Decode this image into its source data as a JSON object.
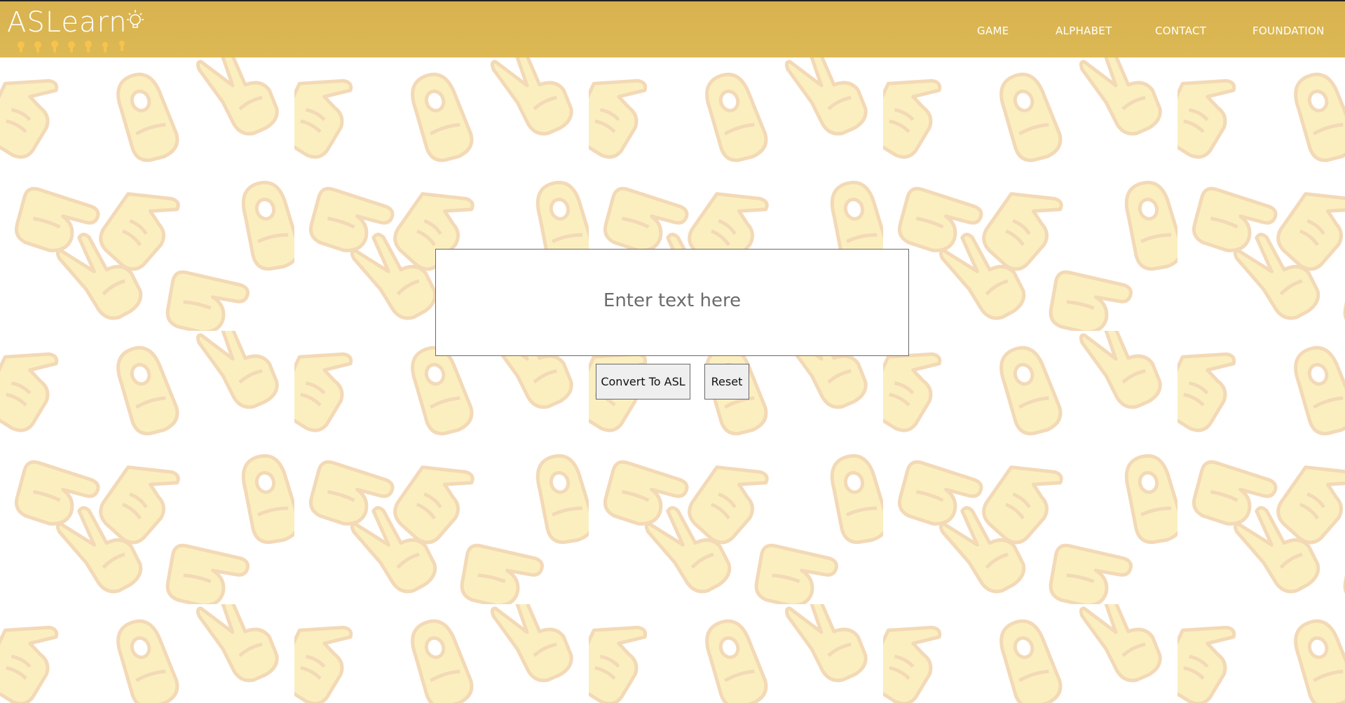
{
  "header": {
    "logo_text": "ASLearn",
    "nav": [
      {
        "label": "GAME"
      },
      {
        "label": "ALPHABET"
      },
      {
        "label": "CONTACT"
      },
      {
        "label": "FOUNDATION"
      }
    ]
  },
  "main": {
    "input_placeholder": "Enter text here",
    "input_value": "",
    "convert_label": "Convert To ASL",
    "reset_label": "Reset"
  },
  "colors": {
    "header": "#d9b44f",
    "pattern_fill": "#fbefc0",
    "pattern_stroke": "#f3d9b6"
  },
  "icons": {
    "logo_bulb": "lightbulb-icon",
    "logo_hands": "hand-signs-icon",
    "background": "hand-sign-pattern"
  }
}
